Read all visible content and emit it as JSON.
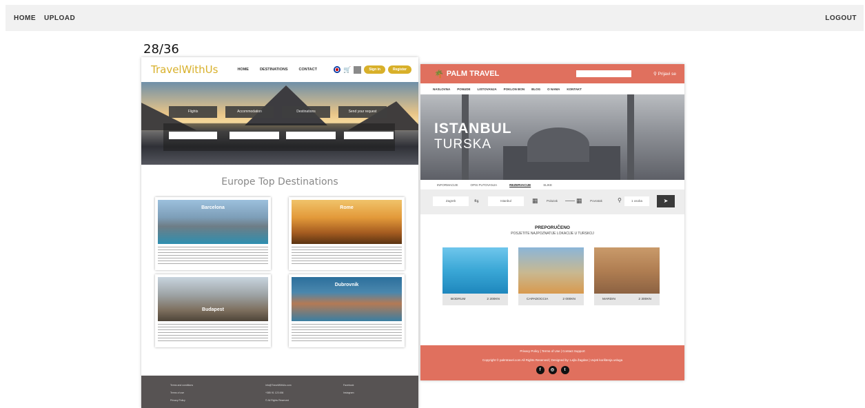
{
  "topnav": {
    "home": "HOME",
    "upload": "UPLOAD",
    "logout": "LOGOUT"
  },
  "counter": "28/36",
  "left": {
    "logo": "TravelWithUs",
    "nav": [
      "HOME",
      "DESTINATIONS",
      "CONTACT"
    ],
    "buttons": {
      "signin": "Sign in",
      "register": "Register"
    },
    "hero_tabs": [
      "Flights",
      "Accommodation",
      "Destinations",
      "Send your request"
    ],
    "section_title": "Europe Top Destinations",
    "cards": [
      "Barcelona",
      "Rome",
      "Budapest",
      "Dubrovnik"
    ],
    "footer": {
      "col1": [
        "Terms and conditions",
        "Terms of use",
        "Privacy Policy"
      ],
      "col2": [
        "info@TravelWithUs.com",
        "+385 91 123 456",
        "© All Rights Reserved"
      ],
      "col3": [
        "Facebook",
        "Instagram"
      ]
    }
  },
  "right": {
    "logo": "PALM TRAVEL",
    "login": "Prijavi se",
    "nav": [
      "NASLOVNA",
      "PONUDE",
      "LISTOVANJA",
      "POKLON BON",
      "BLOG",
      "O NAMA",
      "KONTAKT"
    ],
    "hero_title": "ISTANBUL",
    "hero_subtitle": "TURSKA",
    "tabs": [
      "INFORMACIJE",
      "OPIS PUTOVANJA",
      "REZERVACIJE",
      "SLIKE"
    ],
    "booking": {
      "from": "Zagreb",
      "to": "Istanbul",
      "depart": "Polazak",
      "return": "Povratak",
      "persons": "1 osoba"
    },
    "recommended_title": "PREPORUČENO",
    "recommended_subtitle": "POSJETITE NAJPOZNATIJE LOKACIJE U TURSKOJ",
    "destinations": [
      {
        "name": "BODRUM",
        "price": "2 200KN"
      },
      {
        "name": "CAPADOCCIA",
        "price": "2 000KN"
      },
      {
        "name": "MARDIN",
        "price": "2 300KN"
      }
    ],
    "footer": {
      "links": "Privacy Policy  |  Terms of Use  |  Contact Support",
      "copy": "Copyright © palmtravel.com All Rights Reserved  |  Designed by: Lejla Žagdan  |  Uvjeti korištenja usluga"
    }
  },
  "colors": {
    "left_accent": "#d8b02a",
    "right_brand": "#e0705e",
    "left_footer": "#575353"
  }
}
